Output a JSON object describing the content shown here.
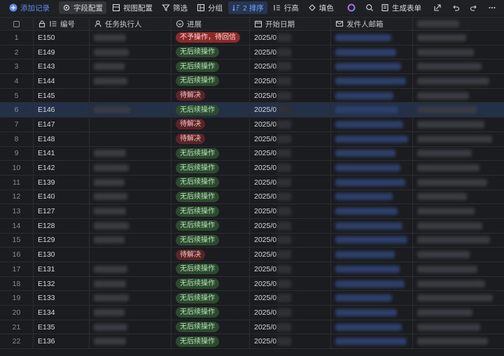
{
  "toolbar": {
    "add_record": "添加记录",
    "field_config": "字段配置",
    "view_config": "视图配置",
    "filter": "筛选",
    "group": "分组",
    "sort": "2 排序",
    "row_height": "行高",
    "fill_color": "填色",
    "generate_form": "生成表单"
  },
  "columns": {
    "code": "编号",
    "executor": "任务执行人",
    "progress": "进展",
    "start_date": "开始日期",
    "sender_email": "发件人邮箱"
  },
  "rows": [
    {
      "index": "1",
      "code": "E150",
      "progress": "不予操作，待回信",
      "status": "red",
      "date": "2025/0"
    },
    {
      "index": "2",
      "code": "E149",
      "progress": "无后续操作",
      "status": "green",
      "date": "2025/0"
    },
    {
      "index": "3",
      "code": "E143",
      "progress": "无后续操作",
      "status": "green",
      "date": "2025/0"
    },
    {
      "index": "4",
      "code": "E144",
      "progress": "无后续操作",
      "status": "green",
      "date": "2025/0"
    },
    {
      "index": "5",
      "code": "E145",
      "progress": "待解决",
      "status": "darkred",
      "date": "2025/0"
    },
    {
      "index": "6",
      "code": "E146",
      "progress": "无后续操作",
      "status": "green",
      "date": "2025/0"
    },
    {
      "index": "7",
      "code": "E147",
      "progress": "待解决",
      "status": "darkred",
      "date": "2025/0"
    },
    {
      "index": "8",
      "code": "E148",
      "progress": "待解决",
      "status": "darkred",
      "date": "2025/0"
    },
    {
      "index": "9",
      "code": "E141",
      "progress": "无后续操作",
      "status": "green",
      "date": "2025/0"
    },
    {
      "index": "10",
      "code": "E142",
      "progress": "无后续操作",
      "status": "green",
      "date": "2025/0"
    },
    {
      "index": "11",
      "code": "E139",
      "progress": "无后续操作",
      "status": "green",
      "date": "2025/0"
    },
    {
      "index": "12",
      "code": "E140",
      "progress": "无后续操作",
      "status": "green",
      "date": "2025/0"
    },
    {
      "index": "13",
      "code": "E127",
      "progress": "无后续操作",
      "status": "green",
      "date": "2025/0"
    },
    {
      "index": "14",
      "code": "E128",
      "progress": "无后续操作",
      "status": "green",
      "date": "2025/0"
    },
    {
      "index": "15",
      "code": "E129",
      "progress": "无后续操作",
      "status": "green",
      "date": "2025/0"
    },
    {
      "index": "16",
      "code": "E130",
      "progress": "待解决",
      "status": "darkred",
      "date": "2025/0"
    },
    {
      "index": "17",
      "code": "E131",
      "progress": "无后续操作",
      "status": "green",
      "date": "2025/0"
    },
    {
      "index": "18",
      "code": "E132",
      "progress": "无后续操作",
      "status": "green",
      "date": "2025/0"
    },
    {
      "index": "19",
      "code": "E133",
      "progress": "无后续操作",
      "status": "green",
      "date": "2025/0"
    },
    {
      "index": "20",
      "code": "E134",
      "progress": "无后续操作",
      "status": "green",
      "date": "2025/0"
    },
    {
      "index": "21",
      "code": "E135",
      "progress": "无后续操作",
      "status": "green",
      "date": "2025/0"
    },
    {
      "index": "22",
      "code": "E136",
      "progress": "无后续操作",
      "status": "green",
      "date": "2025/0"
    }
  ],
  "selected_row": "6",
  "colors": {
    "accent": "#5b8def",
    "green_tag": "#2b4a2e",
    "red_tag": "#8c2a2a"
  }
}
